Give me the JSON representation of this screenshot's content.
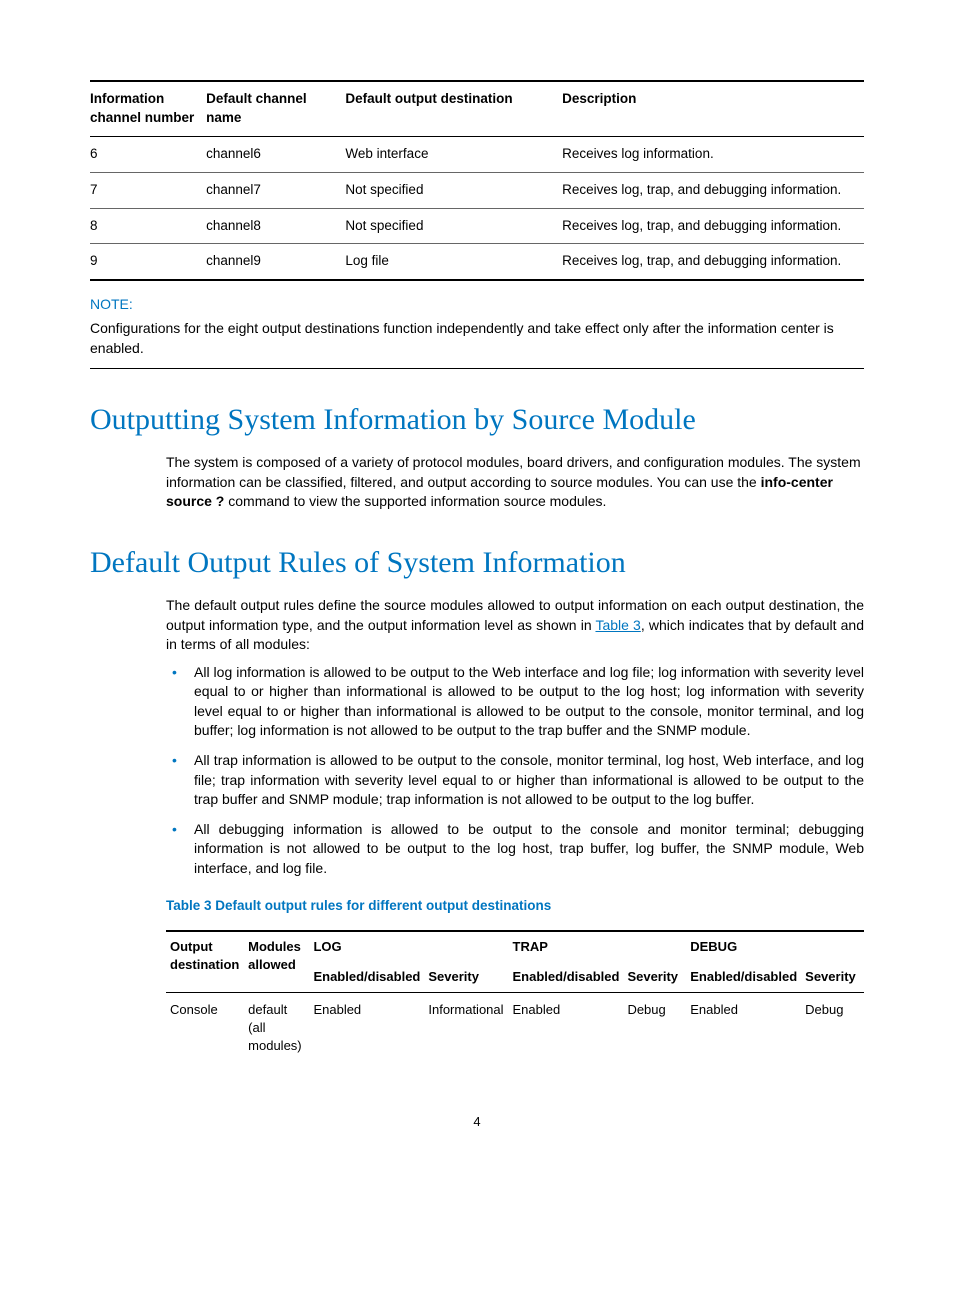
{
  "table1": {
    "headers": [
      "Information channel number",
      "Default channel name",
      "Default output destination",
      "Description"
    ],
    "rows": [
      [
        "6",
        "channel6",
        "Web interface",
        "Receives log information."
      ],
      [
        "7",
        "channel7",
        "Not specified",
        "Receives log, trap, and debugging information."
      ],
      [
        "8",
        "channel8",
        "Not specified",
        "Receives log, trap, and debugging information."
      ],
      [
        "9",
        "channel9",
        "Log file",
        "Receives log, trap, and debugging information."
      ]
    ]
  },
  "note": {
    "label": "NOTE:",
    "text": "Configurations for the eight output destinations function independently and take effect only after the information center is enabled."
  },
  "section1": {
    "title": "Outputting System Information by Source Module",
    "para_pre": "The system is composed of a variety of protocol modules, board drivers, and configuration modules. The system information can be classified, filtered, and output according to source modules. You can use the ",
    "para_bold": "info-center source ?",
    "para_post": " command to view the supported information source modules."
  },
  "section2": {
    "title": "Default Output Rules of System Information",
    "para_pre": "The default output rules define the source modules allowed to output information on each output destination, the output information type, and the output information level as shown in ",
    "link_text": "Table 3",
    "para_post": ", which indicates that by default and in terms of all modules:",
    "bullets": [
      "All log information is allowed to be output to the Web interface and log file; log information with severity level equal to or higher than informational is allowed to be output to the log host; log information with severity level equal to or higher than informational is allowed to be output to the console, monitor terminal, and log buffer; log information is not allowed to be output to the trap buffer and the SNMP module.",
      "All trap information is allowed to be output to the console, monitor terminal, log host, Web interface, and log file; trap information with severity level equal to or higher than informational is allowed to be output to the trap buffer and SNMP module; trap information is not allowed to be output to the log buffer.",
      "All debugging information is allowed to be output to the console and monitor terminal; debugging information is not allowed to be output to the log host, trap buffer, log buffer, the SNMP module, Web interface, and log file."
    ],
    "caption": "Table 3 Default output rules for different output destinations"
  },
  "table2": {
    "group_headers": [
      "LOG",
      "TRAP",
      "DEBUG"
    ],
    "left_headers": [
      "Output destination",
      "Modules allowed"
    ],
    "sub_headers": [
      "Enabled/disabled",
      "Severity",
      "Enabled/disabled",
      "Severity",
      "Enabled/disabled",
      "Severity"
    ],
    "row": [
      "Console",
      "default (all modules)",
      "Enabled",
      "Informational",
      "Enabled",
      "Debug",
      "Enabled",
      "Debug"
    ]
  },
  "page_number": "4"
}
